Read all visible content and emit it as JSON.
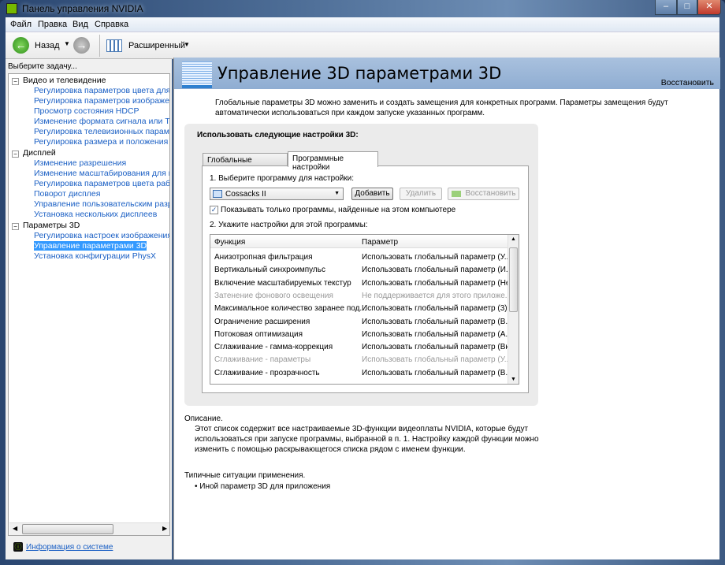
{
  "window": {
    "title": "Панель управления NVIDIA",
    "minimize": "–",
    "maximize": "□",
    "close": "✕"
  },
  "menu": [
    "Файл",
    "Правка",
    "Вид",
    "Справка"
  ],
  "toolbar": {
    "back": "Назад",
    "view": "Расширенный"
  },
  "sidebar": {
    "prompt": "Выберите задачу...",
    "categories": [
      {
        "label": "Видео и телевидение",
        "items": [
          "Регулировка параметров цвета для видео",
          "Регулировка параметров изображения для видео",
          "Просмотр состояния HDCP",
          "Изменение формата сигнала или ТВЧ",
          "Регулировка телевизионных параметров",
          "Регулировка размера и положения экрана"
        ]
      },
      {
        "label": "Дисплей",
        "items": [
          "Изменение разрешения",
          "Изменение масштабирования для мониторов",
          "Регулировка параметров цвета рабочего стола",
          "Поворот дисплея",
          "Управление пользовательским разрешением",
          "Установка нескольких дисплеев"
        ]
      },
      {
        "label": "Параметры 3D",
        "items": [
          "Регулировка настроек изображения с просмотром",
          "Управление параметрами 3D",
          "Установка конфигурации PhysX"
        ]
      }
    ],
    "selected": "Управление параметрами 3D",
    "system_info": "Информация о системе"
  },
  "main": {
    "title": "Управление 3D параметрами 3D",
    "restore": "Восстановить",
    "intro": "Глобальные параметры 3D можно заменить и создать замещения для конкретных программ. Параметры замещения будут автоматически использоваться при каждом запуске указанных программ.",
    "group_label": "Использовать следующие настройки 3D:",
    "tabs": [
      "Глобальные параметры",
      "Программные настройки"
    ],
    "step1": "1. Выберите программу для настройки:",
    "program": "Cossacks II",
    "add": "Добавить",
    "remove": "Удалить",
    "restore_btn": "Восстановить",
    "show_only": "Показывать только программы, найденные на этом компьютере",
    "step2": "2. Укажите настройки для этой программы:",
    "columns": [
      "Функция",
      "Параметр"
    ],
    "rows": [
      [
        "Анизотропная фильтрация",
        "Использовать глобальный параметр (У..."
      ],
      [
        "Вертикальный синхроимпульс",
        "Использовать глобальный параметр (И..."
      ],
      [
        "Включение масштабируемых текстур",
        "Использовать глобальный параметр (Нет)"
      ],
      [
        "Затенение фонового освещения",
        "Не поддерживается для этого приложе..."
      ],
      [
        "Максимальное количество заранее под...",
        "Использовать глобальный параметр (3)"
      ],
      [
        "Ограничение расширения",
        "Использовать глобальный параметр (В..."
      ],
      [
        "Потоковая оптимизация",
        "Использовать глобальный параметр (А..."
      ],
      [
        "Сглаживание - гамма-коррекция",
        "Использовать глобальный параметр (Вкл)"
      ],
      [
        "Сглаживание - параметры",
        "Использовать глобальный параметр (У..."
      ],
      [
        "Сглаживание - прозрачность",
        "Использовать глобальный параметр (В..."
      ]
    ],
    "description_label": "Описание.",
    "description": "Этот список содержит все настраиваемые 3D-функции видеоплаты NVIDIA, которые будут использоваться при запуске программы, выбранной в п. 1. Настройку каждой функции можно изменить с помощью раскрывающегося списка рядом с именем функции.",
    "usage_label": "Типичные ситуации применения.",
    "usage": [
      "Иной параметр 3D для приложения"
    ]
  }
}
